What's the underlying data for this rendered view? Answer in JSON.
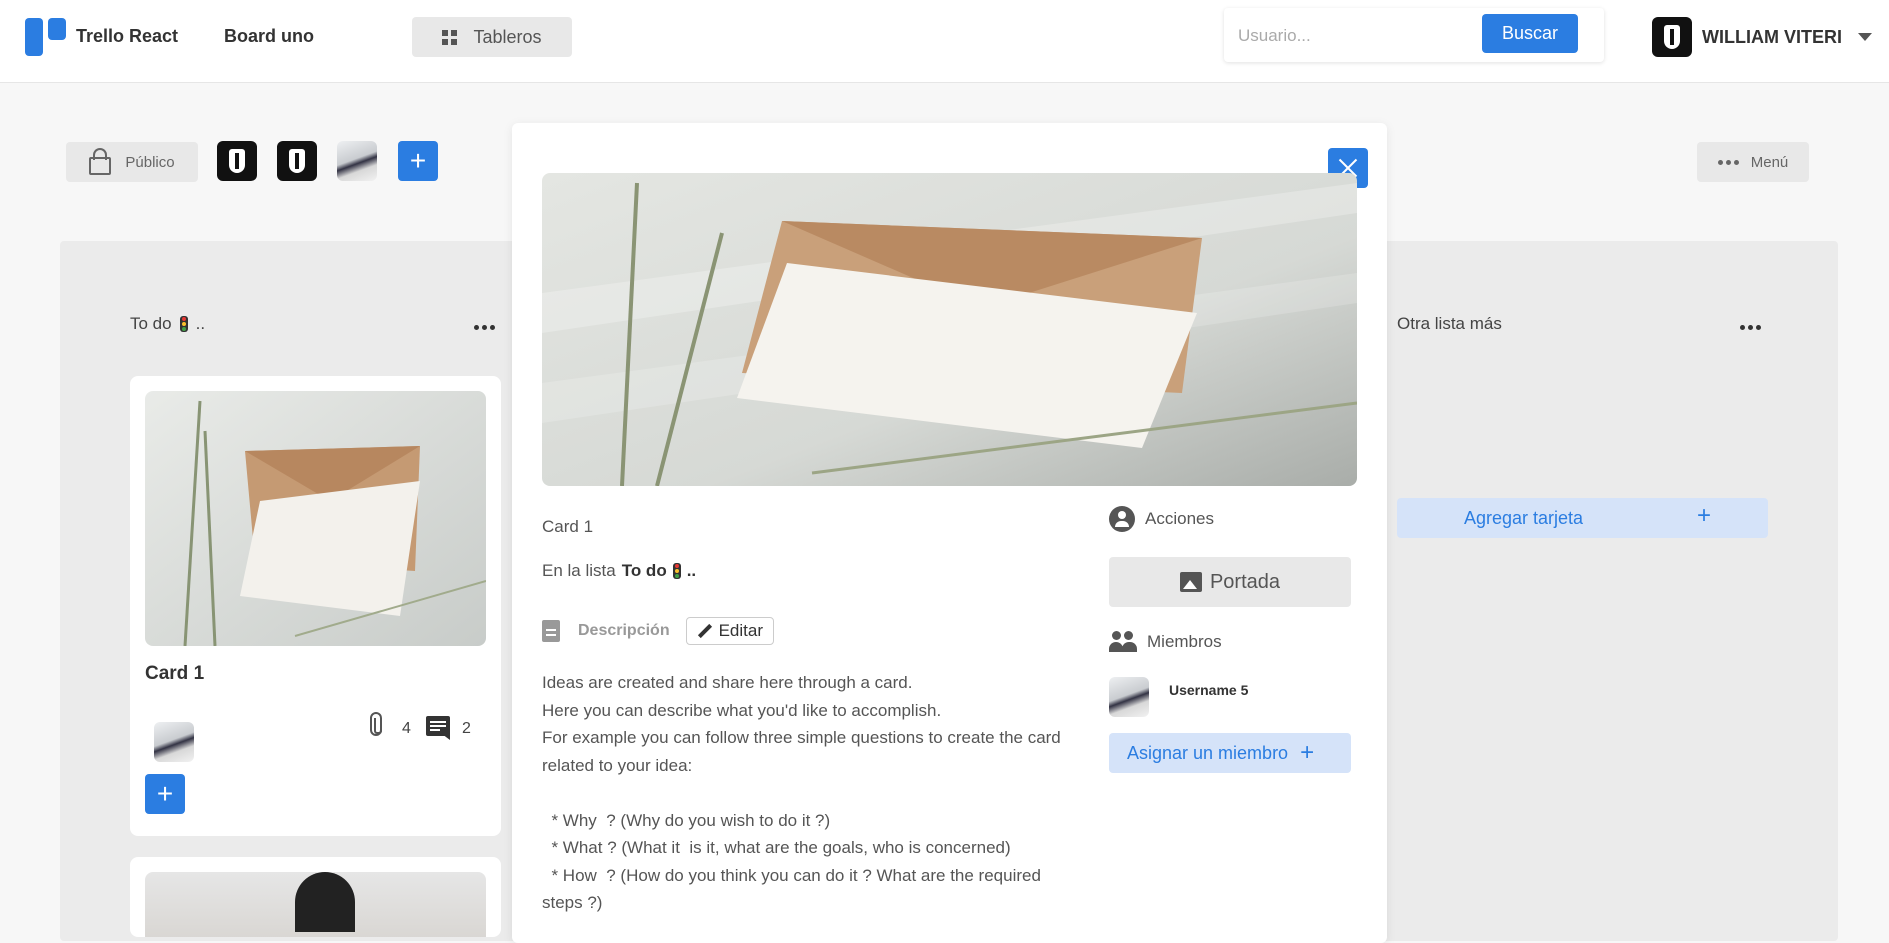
{
  "header": {
    "app_name": "Trello React",
    "board_name": "Board uno",
    "boards_button": "Tableros",
    "search": {
      "placeholder": "Usuario...",
      "value": "",
      "button": "Buscar"
    },
    "user_name": "WILLIAM VITERI"
  },
  "toolbar": {
    "visibility": "Público",
    "menu": "Menú"
  },
  "lists": [
    {
      "title": "To do",
      "title_suffix": "..",
      "cards": [
        {
          "title": "Card 1",
          "attachments": "4",
          "comments": "2"
        }
      ]
    },
    {
      "title": "Otra lista más",
      "add_card": "Agregar tarjeta"
    }
  ],
  "modal": {
    "card_name": "Card 1",
    "list_prefix": "En la lista",
    "list_name": "To do",
    "list_suffix": "..",
    "description_label": "Descripción",
    "edit_button": "Editar",
    "description": "Ideas are created and share here through a card.\nHere you can describe what you'd like to accomplish.\nFor example you can follow three simple questions to create the card related to your idea:\n\n  * Why  ? (Why do you wish to do it ?)\n  * What ? (What it  is it, what are the goals, who is concerned)\n  * How  ? (How do you think you can do it ? What are the required steps ?)",
    "actions_label": "Acciones",
    "cover_button": "Portada",
    "members_label": "Miembros",
    "member_name": "Username 5",
    "assign_button": "Asignar un miembro"
  },
  "colors": {
    "accent": "#2b7de1",
    "light_accent": "#d5e3f9",
    "board_bg": "#ebebeb",
    "button_gray": "#e8e8e8"
  }
}
